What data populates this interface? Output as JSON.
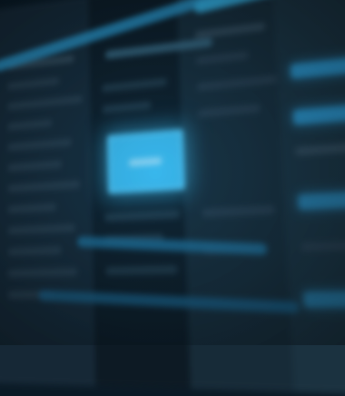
{
  "screen": {
    "description_visible_text": "",
    "primary_button": {
      "label": ""
    },
    "sidebar": {
      "items": [
        "",
        "",
        "",
        "",
        "",
        "",
        "",
        "",
        "",
        "",
        "",
        ""
      ]
    },
    "right_panel": {
      "items": [
        "",
        "",
        "",
        "",
        "",
        ""
      ]
    }
  },
  "colors": {
    "background": "#0a1a26",
    "accent": "#3bbdf2",
    "accent_dark": "#2a8fc4",
    "panel": "#172b38"
  }
}
